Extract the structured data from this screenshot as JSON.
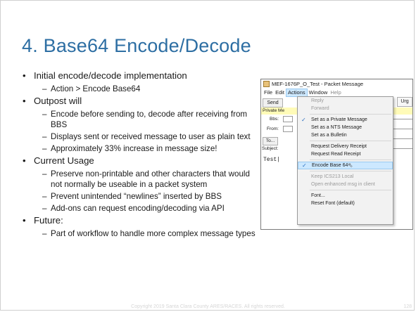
{
  "slide": {
    "title": "4. Base64 Encode/Decode",
    "footer": "Copyright 2019 Santa Clara County ARES/RACES.  All rights reserved.",
    "page_number": "128"
  },
  "bullets": [
    {
      "text": "Initial encode/decode implementation",
      "subs": [
        "Action > Encode Base64"
      ]
    },
    {
      "text": "Outpost will",
      "subs": [
        "Encode before sending to, decode after receiving from BBS",
        "Displays sent or received message to user as plain text",
        "Approximately 33% increase in message size!"
      ]
    },
    {
      "text": "Current Usage",
      "subs": [
        "Preserve non-printable and other characters that would not normally be useable in a packet system",
        "Prevent unintended “newlines” inserted by BBS",
        "Add-ons can request encoding/decoding via API"
      ]
    },
    {
      "text": "Future:",
      "subs": [
        "Part of workflow to handle more complex message types"
      ]
    }
  ],
  "window": {
    "title": "MEF-1676P_O_Test - Packet Message",
    "menu": [
      "File",
      "Edit",
      "Actions",
      "Window",
      "Help"
    ],
    "send_label": "Send",
    "private_label": "Private Me",
    "bbs_label": "Bbs:",
    "from_label": "From:",
    "to_label": "To...",
    "subject_label": "Subject:",
    "urg_label": "Urg",
    "body_text": "Test|"
  },
  "actions_menu": {
    "reply": "Reply",
    "forward": "Forward",
    "private": "Set as a Private Message",
    "nts": "Set as a NTS Message",
    "bulletin": "Set as a Bulletin",
    "delivery": "Request Delivery Receipt",
    "read": "Request Read Receipt",
    "encode": "Encode Base 64",
    "keep_ics": "Keep ICS213 Local",
    "open_enhanced": "Open enhanced msg in client",
    "font": "Font...",
    "reset_font": "Reset Font (default)"
  },
  "colors": {
    "title": "#2d6ea3",
    "highlight": "#cce8ff",
    "private_bar": "#fffbb8"
  }
}
